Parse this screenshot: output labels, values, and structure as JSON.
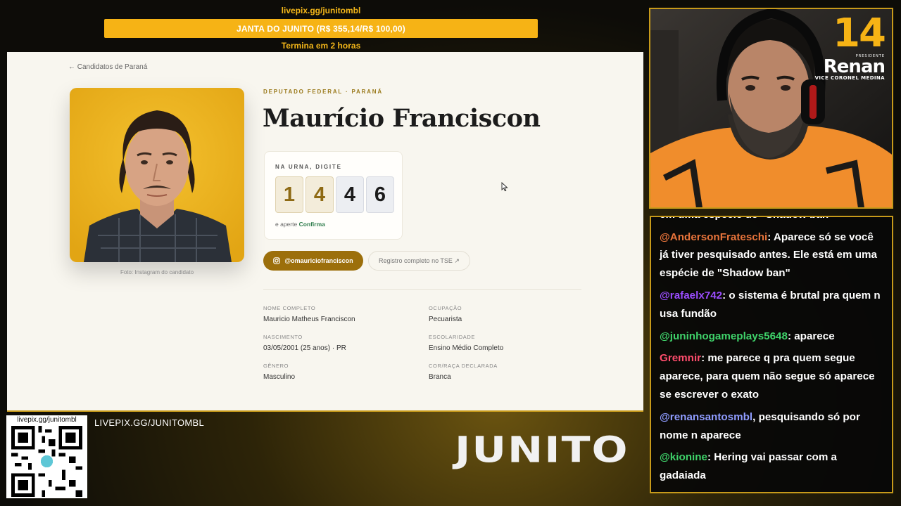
{
  "donation": {
    "link": "livepix.gg/junitombl",
    "goal_text": "JANTA DO JUNITO (R$ 355,14/R$ 100,00)",
    "ends_text": "Termina em 2 horas"
  },
  "page": {
    "back_link": "← Candidatos de Paraná",
    "photo_credit": "Foto: Instagram do candidato",
    "kicker": "DEPUTADO FEDERAL · PARANÁ",
    "name": "Maurício Franciscon",
    "ballot": {
      "label": "NA URNA, DIGITE",
      "digits": [
        "1",
        "4",
        "4",
        "6"
      ],
      "confirm_prefix": "e aperte",
      "confirm_word": "Confirma"
    },
    "instagram_button": "@omauriciofranciscon",
    "tse_button": "Registro completo no TSE ↗",
    "fields": {
      "nome_label": "NOME COMPLETO",
      "nome_value": "Mauricio Matheus Franciscon",
      "ocupacao_label": "OCUPAÇÃO",
      "ocupacao_value": "Pecuarista",
      "nascimento_label": "NASCIMENTO",
      "nascimento_value": "03/05/2001 (25 anos) · PR",
      "escolaridade_label": "ESCOLARIDADE",
      "escolaridade_value": "Ensino Médio Completo",
      "genero_label": "GÊNERO",
      "genero_value": "Masculino",
      "cor_label": "COR/RAÇA DECLARADA",
      "cor_value": "Branca"
    }
  },
  "webcam": {
    "overlay_number": "14",
    "overlay_small_top": "PRESIDENTE",
    "overlay_name": "Renan",
    "overlay_vice": "VICE CORONEL MEDINA"
  },
  "chat": [
    {
      "user": "",
      "text": "em uma espécie de \"Shadow ban\"",
      "color": "#ffffff"
    },
    {
      "user": "@AndersonFrateschi",
      "text": ": Aparece só se você já tiver pesquisado antes. Ele está em uma espécie de \"Shadow ban\"",
      "color": "#e8743b"
    },
    {
      "user": "@rafaelx742",
      "text": ": o sistema é brutal pra quem n usa fundão",
      "color": "#9b4dff"
    },
    {
      "user": "@juninhogameplays5648",
      "text": ": aparece",
      "color": "#3fd26a"
    },
    {
      "user": "Gremnir",
      "text": ": me parece q pra quem segue aparece, para quem não segue só aparece se escrever o exato",
      "color": "#ff4d6d"
    },
    {
      "user": "@renansantosmbl",
      "text": ", pesquisando só por nome n aparece",
      "color": "#8f9cff"
    },
    {
      "user": "@kionine",
      "text": ": Hering vai passar com a gadaiada",
      "color": "#3fd26a"
    }
  ],
  "footer": {
    "qr_url": "livepix.gg/junitombl",
    "link": "LIVEPIX.GG/JUNITOMBL",
    "brand": "JUNITO"
  },
  "colors": {
    "accent_gold": "#f6b315",
    "frame_gold": "#c79a1a",
    "instagram_button": "#9c6f0b",
    "confirm_green": "#2f7d4d"
  }
}
